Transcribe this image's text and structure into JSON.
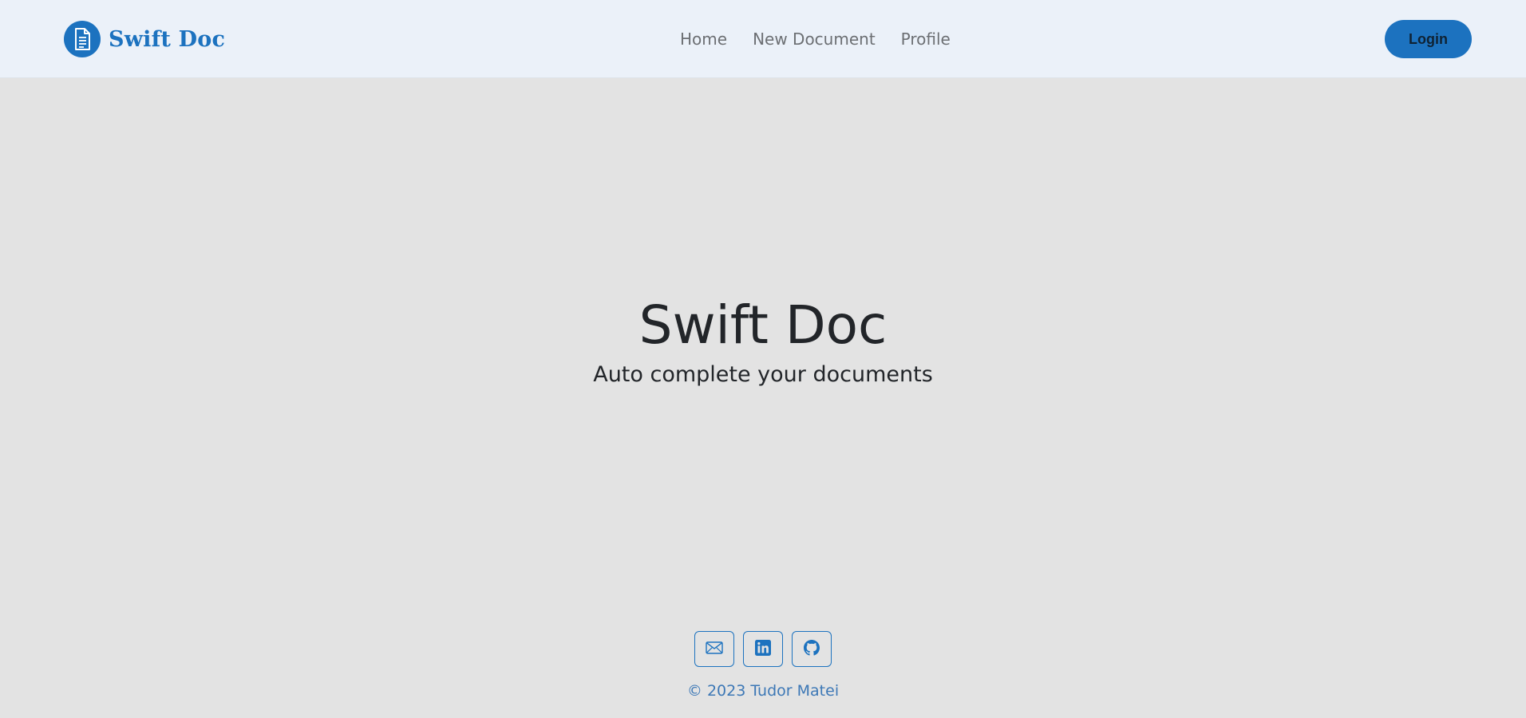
{
  "header": {
    "brand_name": "Swift Doc",
    "brand_icon": "document-icon",
    "nav": [
      {
        "label": "Home"
      },
      {
        "label": "New Document"
      },
      {
        "label": "Profile"
      }
    ],
    "login_label": "Login"
  },
  "hero": {
    "title": "Swift Doc",
    "subtitle": "Auto complete your documents"
  },
  "footer": {
    "social": [
      {
        "icon": "mail-icon"
      },
      {
        "icon": "linkedin-icon"
      },
      {
        "icon": "github-icon"
      }
    ],
    "copyright": "© 2023 Tudor Matei"
  },
  "colors": {
    "accent": "#1c72bf",
    "navbar_bg": "#ebf1f9",
    "page_bg": "#e3e3e3",
    "text_dark": "#222529",
    "nav_text": "#6c6f73"
  }
}
